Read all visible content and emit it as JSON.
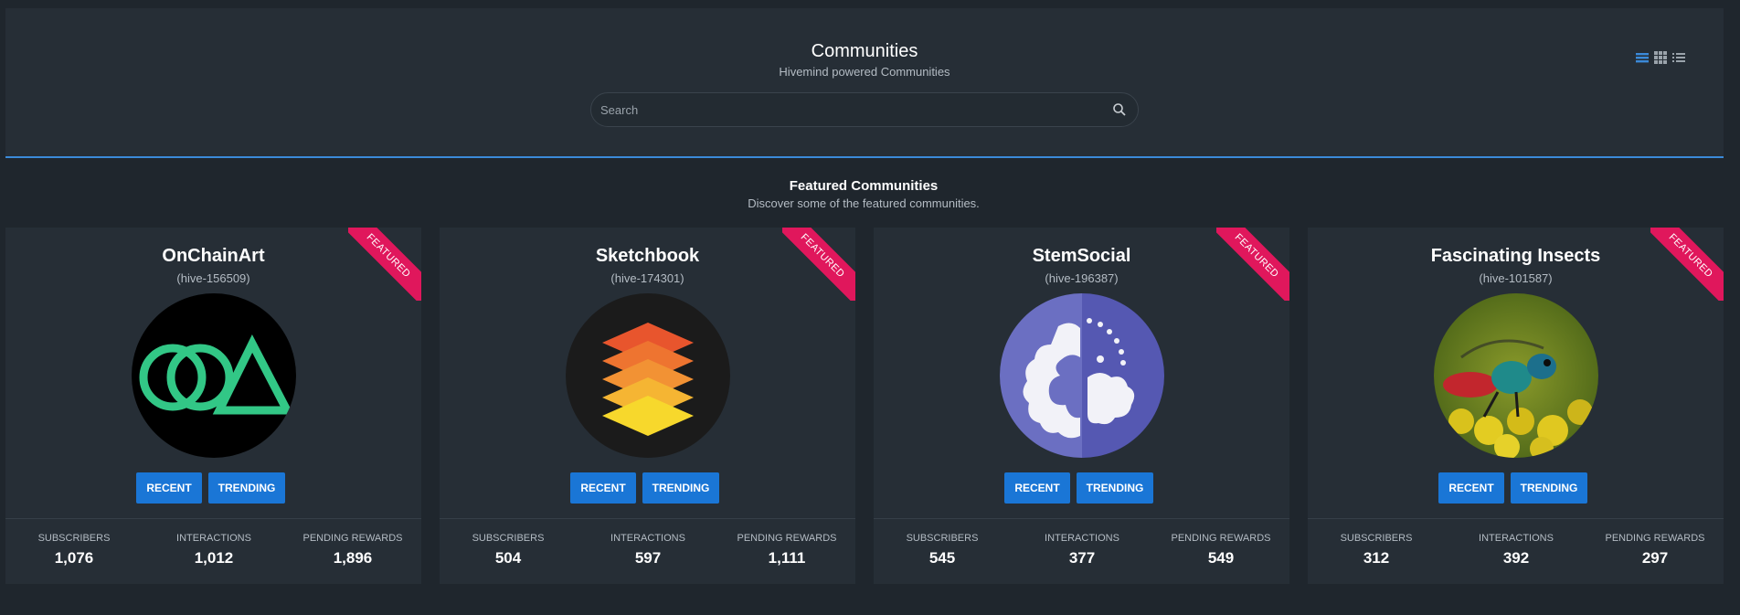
{
  "header": {
    "title": "Communities",
    "subtitle": "Hivemind powered Communities",
    "search_placeholder": "Search"
  },
  "view_toggles": [
    "list-view-icon",
    "grid-view-icon",
    "compact-list-icon"
  ],
  "section": {
    "title": "Featured Communities",
    "subtitle": "Discover some of the featured communities."
  },
  "labels": {
    "featured": "FEATURED",
    "recent": "RECENT",
    "trending": "TRENDING",
    "subscribers": "SUBSCRIBERS",
    "interactions": "INTERACTIONS",
    "pending_rewards": "PENDING REWARDS"
  },
  "colors": {
    "accent": "#1a76d6",
    "ribbon": "#e0175c",
    "header_border": "#3b8ad9"
  },
  "communities": [
    {
      "name": "OnChainArt",
      "id": "(hive-156509)",
      "subscribers": "1,076",
      "interactions": "1,012",
      "pending_rewards": "1,896",
      "logo": "onchainart-logo"
    },
    {
      "name": "Sketchbook",
      "id": "(hive-174301)",
      "subscribers": "504",
      "interactions": "597",
      "pending_rewards": "1,111",
      "logo": "sketchbook-layers-logo"
    },
    {
      "name": "StemSocial",
      "id": "(hive-196387)",
      "subscribers": "545",
      "interactions": "377",
      "pending_rewards": "549",
      "logo": "stemsocial-brain-logo"
    },
    {
      "name": "Fascinating Insects",
      "id": "(hive-101587)",
      "subscribers": "312",
      "interactions": "392",
      "pending_rewards": "297",
      "logo": "insect-photo"
    }
  ]
}
